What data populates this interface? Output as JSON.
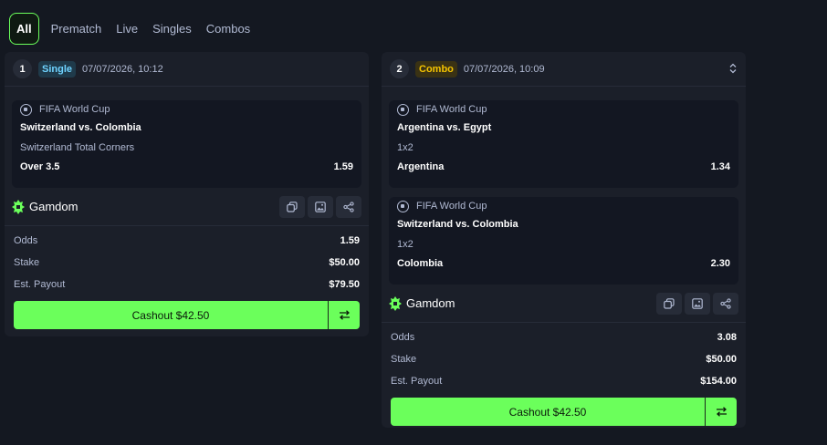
{
  "tabs": [
    {
      "label": "All",
      "active": true
    },
    {
      "label": "Prematch",
      "active": false
    },
    {
      "label": "Live",
      "active": false
    },
    {
      "label": "Singles",
      "active": false
    },
    {
      "label": "Combos",
      "active": false
    }
  ],
  "bets": [
    {
      "index": "1",
      "type": "Single",
      "date": "07/07/2026, 10:12",
      "legs": [
        {
          "competition": "FIFA World Cup",
          "match": "Switzerland vs. Colombia",
          "market": "Switzerland Total Corners",
          "selection": "Over 3.5",
          "odds": "1.59"
        }
      ],
      "brand": "Gamdom",
      "odds_label": "Odds",
      "odds_value": "1.59",
      "stake_label": "Stake",
      "stake_value": "$50.00",
      "payout_label": "Est. Payout",
      "payout_value": "$79.50",
      "cashout_label": "Cashout $42.50"
    },
    {
      "index": "2",
      "type": "Combo",
      "date": "07/07/2026, 10:09",
      "legs": [
        {
          "competition": "FIFA World Cup",
          "match": "Argentina vs. Egypt",
          "market": "1x2",
          "selection": "Argentina",
          "odds": "1.34"
        },
        {
          "competition": "FIFA World Cup",
          "match": "Switzerland vs. Colombia",
          "market": "1x2",
          "selection": "Colombia",
          "odds": "2.30"
        }
      ],
      "brand": "Gamdom",
      "odds_label": "Odds",
      "odds_value": "3.08",
      "stake_label": "Stake",
      "stake_value": "$50.00",
      "payout_label": "Est. Payout",
      "payout_value": "$154.00",
      "cashout_label": "Cashout $42.50"
    }
  ],
  "colors": {
    "accent": "#6bff5b",
    "background": "#141821",
    "card": "#1b1f29",
    "single_badge": "#6fd3ff",
    "combo_badge": "#f5c400"
  },
  "icons": [
    "soccer-ball-icon",
    "gamdom-logo-icon",
    "copy-icon",
    "image-icon",
    "share-icon",
    "swap-icon",
    "chevron-updown-icon"
  ]
}
